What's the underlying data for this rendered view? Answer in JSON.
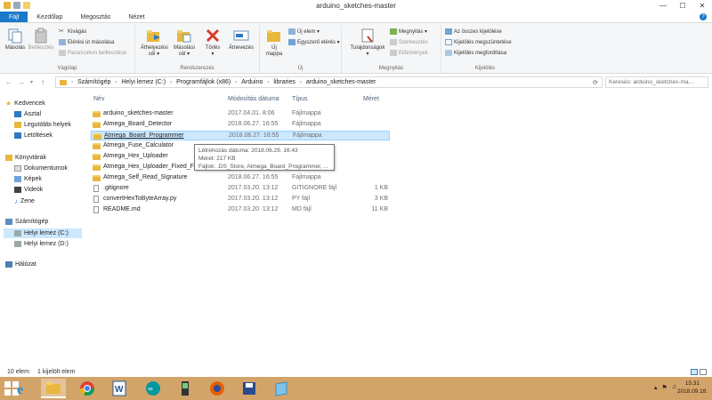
{
  "window": {
    "title": "arduino_sketches-master",
    "controls": [
      "—",
      "☐",
      "✕"
    ]
  },
  "tabs": [
    {
      "label": "Fájl"
    },
    {
      "label": "Kezdőlap"
    },
    {
      "label": "Megosztás"
    },
    {
      "label": "Nézet"
    }
  ],
  "help_glyph": "?",
  "ribbon": {
    "clipboard": {
      "group_label": "Vágólap",
      "copy": "Másolás",
      "paste": "Beillesztés",
      "cut": "Kivágás",
      "copy_path": "Elérési út másolása",
      "paste_shortcut": "Parancsikon beillesztése"
    },
    "organize": {
      "group_label": "Rendszerezés",
      "move_to_1": "Áthelyezési",
      "move_to_2": "cél ▾",
      "copy_to_1": "Másolási",
      "copy_to_2": "cél ▾",
      "delete_1": "Törlés",
      "delete_2": "▾",
      "rename": "Átnevezés"
    },
    "new": {
      "group_label": "Új",
      "new_folder_1": "Új",
      "new_folder_2": "mappa",
      "new_item": "Új elem ▾",
      "easy_access": "Egyszerű elérés ▾"
    },
    "open": {
      "group_label": "Megnyitás",
      "properties_1": "Tulajdonságok",
      "properties_2": "▾",
      "open": "Megnyitás ▾",
      "edit": "Szerkesztés",
      "history": "Előzmények"
    },
    "select": {
      "group_label": "Kijelölés",
      "select_all": "Az összes kijelölése",
      "select_none": "Kijelölés megszüntetése",
      "invert": "Kijelölés megfordítása"
    }
  },
  "address": {
    "crumbs": [
      "Számítógép",
      "Helyi lemez (C:)",
      "Programfájlok (x86)",
      "Arduino",
      "libraries",
      "arduino_sketches-master"
    ],
    "search_placeholder": "Keresés: arduino_sketches-ma..."
  },
  "nav": {
    "favorites": "Kedvencek",
    "desktop": "Asztal",
    "recent": "Legutóbbi helyek",
    "downloads": "Letöltések",
    "libraries": "Könyvtárak",
    "documents": "Dokumentumok",
    "pictures": "Képek",
    "videos": "Videók",
    "music": "Zene",
    "computer": "Számítógép",
    "drive_c": "Helyi lemez (C:)",
    "drive_d": "Helyi lemez (D:)",
    "network": "Hálózat"
  },
  "columns": {
    "name": "Név",
    "date": "Módosítás dátuma",
    "type": "Típus",
    "size": "Méret"
  },
  "files": [
    {
      "name": "arduino_sketches-master",
      "date": "2017.04.01. 8:06",
      "type": "Fájlmappa",
      "size": ""
    },
    {
      "name": "Atmega_Board_Detector",
      "date": "2018.06.27. 16:55",
      "type": "Fájlmappa",
      "size": ""
    },
    {
      "name": "Atmega_Board_Programmer",
      "date": "2018.06.27. 16:55",
      "type": "Fájlmappa",
      "size": ""
    },
    {
      "name": "Atmega_Fuse_Calculator",
      "date": "",
      "type": "",
      "size": ""
    },
    {
      "name": "Atmega_Hex_Uploader",
      "date": "",
      "type": "",
      "size": ""
    },
    {
      "name": "Atmega_Hex_Uploader_Fixed_File",
      "date": "",
      "type": "",
      "size": ""
    },
    {
      "name": "Atmega_Self_Read_Signature",
      "date": "2018.06.27. 16:55",
      "type": "Fájlmappa",
      "size": ""
    },
    {
      "name": ".gitignore",
      "date": "2017.03.20. 13:12",
      "type": "GITIGNORE fájl",
      "size": "1 KB"
    },
    {
      "name": "convertHexToByteArray.py",
      "date": "2017.03.20. 13:12",
      "type": "PY fájl",
      "size": "3 KB"
    },
    {
      "name": "README.md",
      "date": "2017.03.20. 13:12",
      "type": "MD fájl",
      "size": "11 KB"
    }
  ],
  "tooltip": {
    "created": "Létrehozás dátuma: 2018.06.29. 16:43",
    "size": "Méret: 217 KB",
    "files": "Fájlok: .DS_Store, Atmega_Board_Programmer, ..."
  },
  "status": {
    "count": "10 elem",
    "selected": "1 kijelölt elem"
  },
  "taskbar": {
    "time": "15:31",
    "date": "2018.09.18."
  }
}
